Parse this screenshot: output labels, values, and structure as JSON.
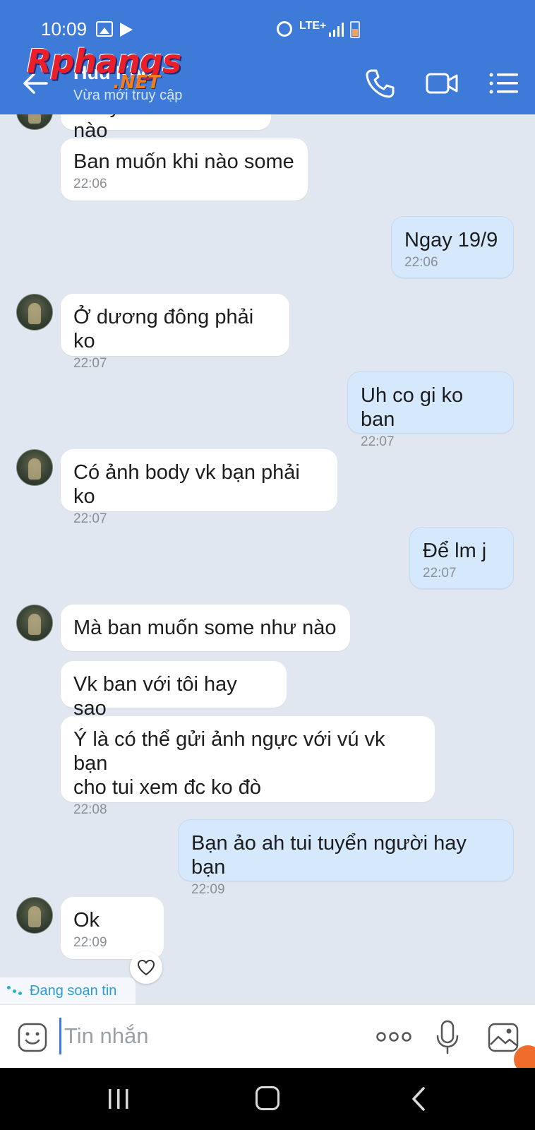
{
  "status_bar": {
    "time": "10:09",
    "network": "LTE+",
    "icons": [
      "gallery-icon",
      "play-store-icon",
      "alarm-icon",
      "lte-icon",
      "signal-icon",
      "battery-icon"
    ]
  },
  "header": {
    "contact_name": "Huu Kho",
    "contact_status": "Vừa mới truy cập",
    "accent_color": "#3e7bd9"
  },
  "watermark": {
    "main": "Rphangs",
    "suffix": ".NET"
  },
  "messages": [
    {
      "direction": "in",
      "text": "Body vk ban thế nào",
      "time": ""
    },
    {
      "direction": "in",
      "text": "Ban muốn khi nào some",
      "time": "22:06"
    },
    {
      "direction": "out",
      "text": "Ngay 19/9",
      "time": "22:06"
    },
    {
      "direction": "in",
      "text": "Ở dương đông phải ko",
      "time": "22:07"
    },
    {
      "direction": "out",
      "text": "Uh co gi ko ban",
      "time": "22:07"
    },
    {
      "direction": "in",
      "text": "Có ảnh body vk bạn phải ko",
      "time": "22:07"
    },
    {
      "direction": "out",
      "text": "Để lm j",
      "time": "22:07"
    },
    {
      "direction": "in",
      "text": "Mà ban muốn some như nào",
      "time": ""
    },
    {
      "direction": "in",
      "text": "Vk ban với tôi hay sao",
      "time": ""
    },
    {
      "direction": "in",
      "text": "Ý là có thể gửi ảnh ngực với vú vk bạn\ncho tui xem đc ko đò",
      "time": "22:08"
    },
    {
      "direction": "out",
      "text": "Bạn ảo ah tui tuyển người hay bạn",
      "time": "22:09"
    },
    {
      "direction": "in",
      "text": "Ok",
      "time": "22:09"
    }
  ],
  "typing_indicator": "Đang soạn tin",
  "composer": {
    "placeholder": "Tin nhắn",
    "value": ""
  },
  "colors": {
    "chat_background": "#e1e7f0",
    "incoming_bubble": "#ffffff",
    "outgoing_bubble": "#d6e9fc",
    "typing_text": "#2c9bd6"
  }
}
